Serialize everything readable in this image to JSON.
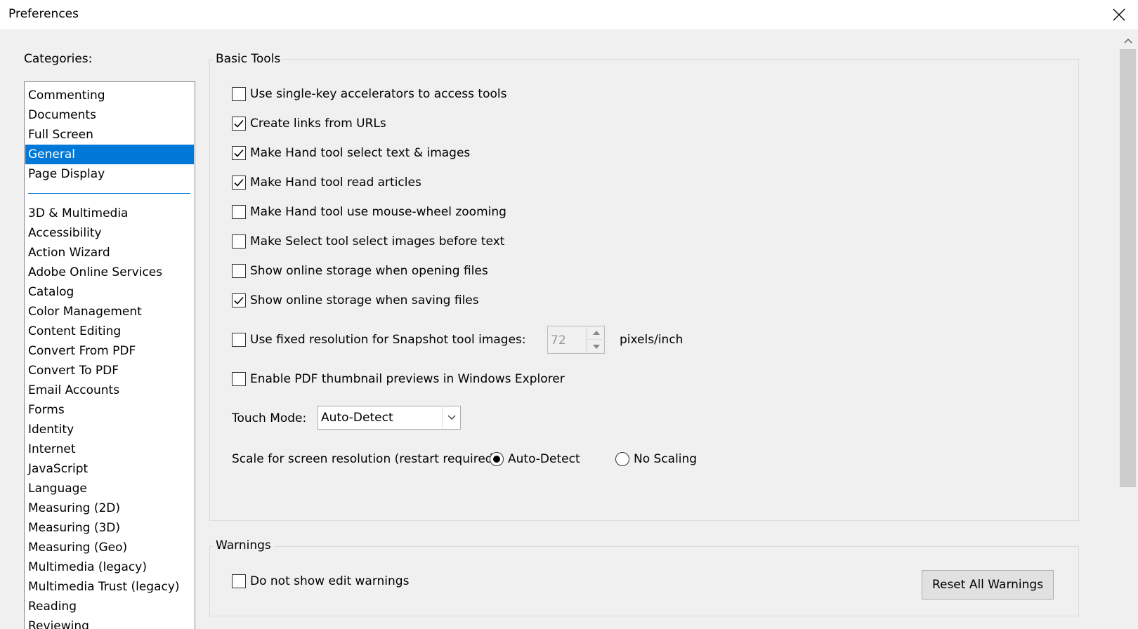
{
  "window": {
    "title": "Preferences"
  },
  "categories": {
    "label": "Categories:",
    "primary": [
      "Commenting",
      "Documents",
      "Full Screen",
      "General",
      "Page Display"
    ],
    "secondary": [
      "3D & Multimedia",
      "Accessibility",
      "Action Wizard",
      "Adobe Online Services",
      "Catalog",
      "Color Management",
      "Content Editing",
      "Convert From PDF",
      "Convert To PDF",
      "Email Accounts",
      "Forms",
      "Identity",
      "Internet",
      "JavaScript",
      "Language",
      "Measuring (2D)",
      "Measuring (3D)",
      "Measuring (Geo)",
      "Multimedia (legacy)",
      "Multimedia Trust (legacy)",
      "Reading",
      "Reviewing"
    ],
    "selected": "General"
  },
  "basic_tools": {
    "title": "Basic Tools",
    "options": [
      {
        "label": "Use single-key accelerators to access tools",
        "checked": false
      },
      {
        "label": "Create links from URLs",
        "checked": true
      },
      {
        "label": "Make Hand tool select text & images",
        "checked": true
      },
      {
        "label": "Make Hand tool read articles",
        "checked": true
      },
      {
        "label": "Make Hand tool use mouse-wheel zooming",
        "checked": false
      },
      {
        "label": "Make Select tool select images before text",
        "checked": false
      },
      {
        "label": "Show online storage when opening files",
        "checked": false
      },
      {
        "label": "Show online storage when saving files",
        "checked": true
      }
    ],
    "snapshot": {
      "label": "Use fixed resolution for Snapshot tool images:",
      "checked": false,
      "value": "72",
      "unit": "pixels/inch"
    },
    "thumbnail": {
      "label": "Enable PDF thumbnail previews in Windows Explorer",
      "checked": false
    },
    "touch_mode": {
      "label": "Touch Mode:",
      "value": "Auto-Detect"
    },
    "scale": {
      "label": "Scale for screen resolution (restart required):",
      "option_auto": "Auto-Detect",
      "option_none": "No Scaling",
      "selected": "Auto-Detect"
    }
  },
  "warnings": {
    "title": "Warnings",
    "option": {
      "label": "Do not show edit warnings",
      "checked": false
    },
    "reset_label": "Reset All Warnings"
  }
}
